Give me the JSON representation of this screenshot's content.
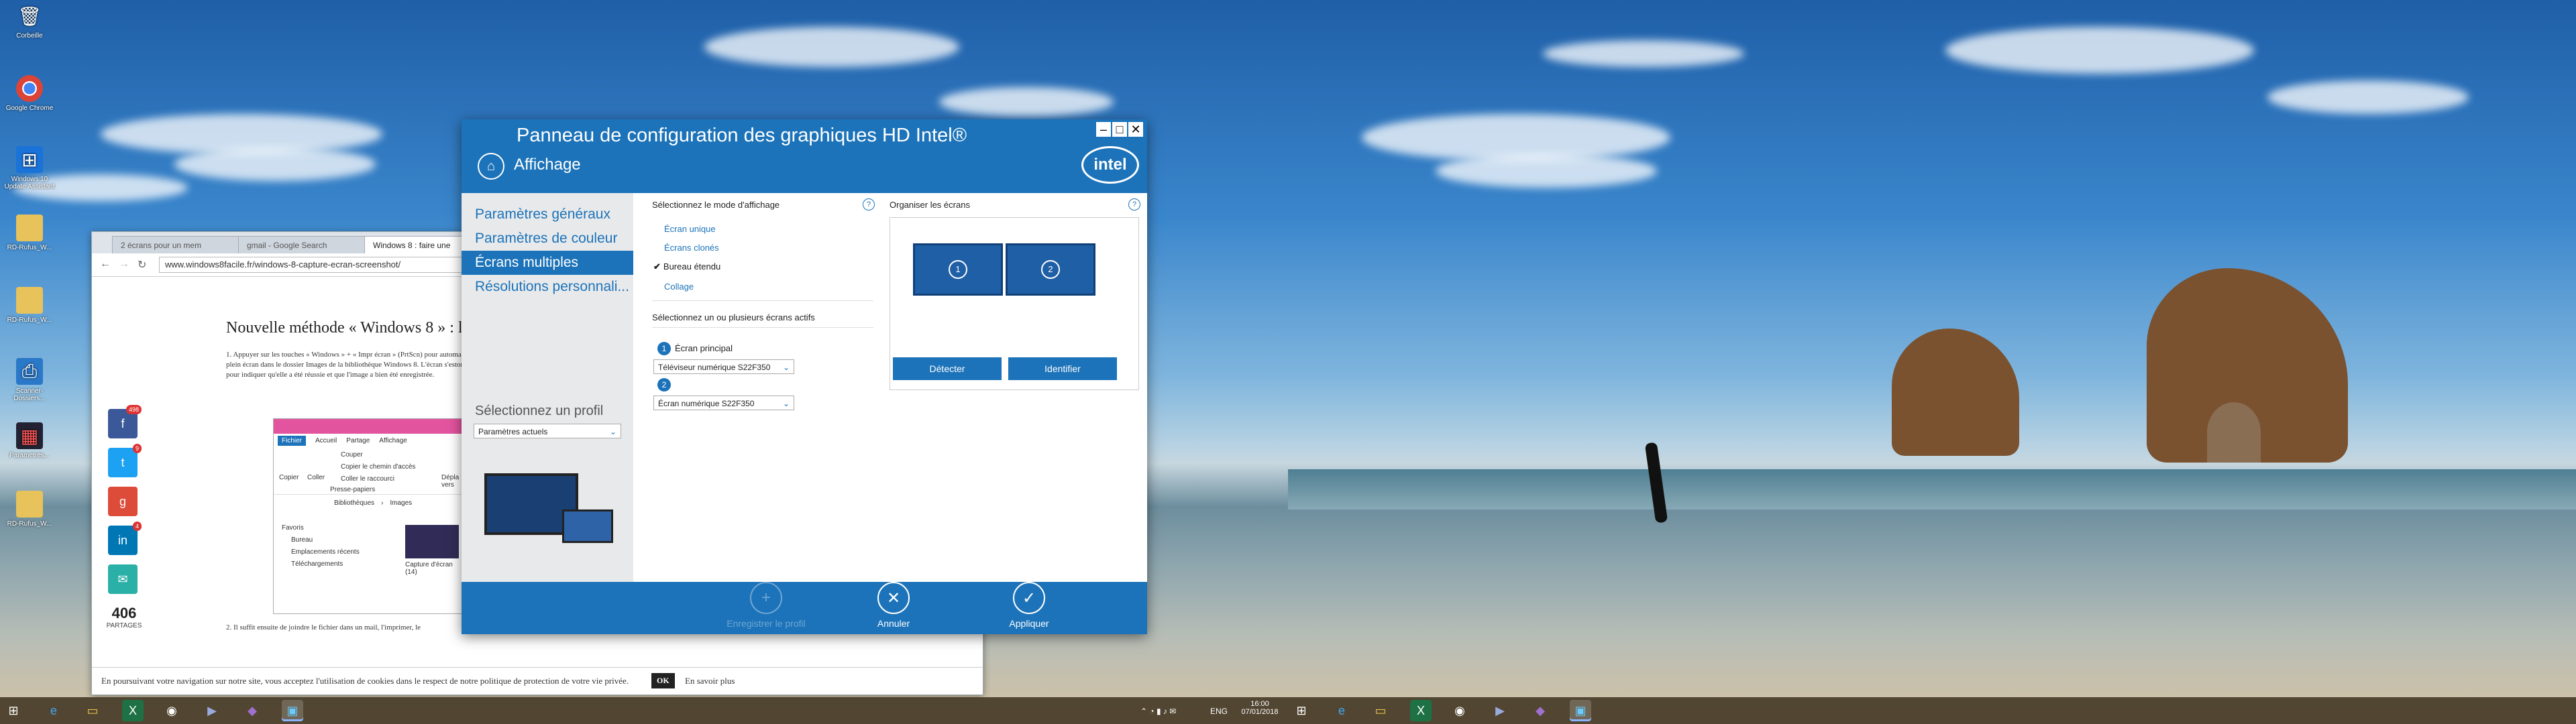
{
  "desktop_icons": [
    {
      "label": "Corbeille",
      "icon": "recycle-bin-icon"
    },
    {
      "label": "Google Chrome",
      "icon": "chrome-icon"
    },
    {
      "label": "Windows 10 Update Assistant",
      "icon": "windows-icon"
    },
    {
      "label": "RD-Rufus_W...",
      "icon": "folder-icon"
    },
    {
      "label": "RD-Rufus_W...",
      "icon": "folder-icon"
    },
    {
      "label": "Scanner-Dossiers...",
      "icon": "scanner-icon"
    },
    {
      "label": "Parametres...",
      "icon": "app-icon"
    },
    {
      "label": "RD-Rufus_W...",
      "icon": "folder-icon"
    }
  ],
  "browser": {
    "tabs": [
      "2 écrans pour un mem",
      "gmail - Google Search",
      "Windows 8 : faire une"
    ],
    "url": "www.windows8facile.fr/windows-8-capture-ecran-screenshot/",
    "page_title": "Nouvelle méthode « Windows 8 » : la p",
    "paragraph1": "1. Appuyer sur les touches « Windows » + « Impr écran » (PrtScn) pour automatiquement enregistrer une capture plein écran dans le dossier Images de la bibliothèque Windows 8. L'écran s'estompe brièvement lors de la capture pour indiquer qu'elle a été réussie et que l'image a bien été enregistrée.",
    "paragraph2": "2. Il suffit ensuite de joindre le fichier dans un mail, l'imprimer, le",
    "share_count": "406",
    "share_label": "PARTAGES",
    "share_badges": [
      "498",
      "9",
      "",
      "4",
      ""
    ],
    "explorer": {
      "tabs": [
        "Fichier",
        "Accueil",
        "Partage",
        "Affichage"
      ],
      "cmds": [
        "Couper",
        "Copier le chemin d'accès",
        "Coller le raccourci",
        "Presse-papiers",
        "Copier",
        "Coller",
        "Dépla vers"
      ],
      "path": [
        "Bibliothèques",
        "Images"
      ],
      "nav": [
        "Favoris",
        "Bureau",
        "Emplacements récents",
        "Téléchargements"
      ],
      "item": "Capture d'écran (14)"
    },
    "cookie_text": "En poursuivant votre navigation sur notre site, vous acceptez l'utilisation de cookies dans le respect de notre politique de protection de votre vie privée.",
    "cookie_ok": "OK",
    "cookie_more": "En savoir plus"
  },
  "intel": {
    "title": "Panneau de configuration des graphiques HD Intel®",
    "subtitle": "Affichage",
    "logo": "intel",
    "sidebar": [
      {
        "label": "Paramètres généraux",
        "active": false
      },
      {
        "label": "Paramètres de couleur",
        "active": false
      },
      {
        "label": "Écrans multiples",
        "active": true
      },
      {
        "label": "Résolutions personnali...",
        "active": false
      }
    ],
    "profile_label": "Sélectionnez un profil",
    "profile_value": "Paramètres actuels",
    "mode_title": "Sélectionnez le mode d'affichage",
    "modes": [
      {
        "label": "Écran unique",
        "checked": false
      },
      {
        "label": "Écrans clonés",
        "checked": false
      },
      {
        "label": "Bureau étendu",
        "checked": true
      },
      {
        "label": "Collage",
        "checked": false
      }
    ],
    "active_title": "Sélectionnez un ou plusieurs écrans actifs",
    "primary_label": "Écran principal",
    "display1_num": "1",
    "display1": "Téléviseur numérique S22F350",
    "display2_num": "2",
    "display2": "Écran numérique S22F350",
    "arrange_title": "Organiser les écrans",
    "screen1": "1",
    "screen2": "2",
    "detect": "Détecter",
    "identify": "Identifier",
    "help": "?",
    "footer": {
      "save": "Enregistrer le profil",
      "cancel": "Annuler",
      "apply": "Appliquer"
    }
  },
  "taskbar": {
    "lang": "ENG",
    "time": "16:00",
    "date": "07/01/2018"
  }
}
